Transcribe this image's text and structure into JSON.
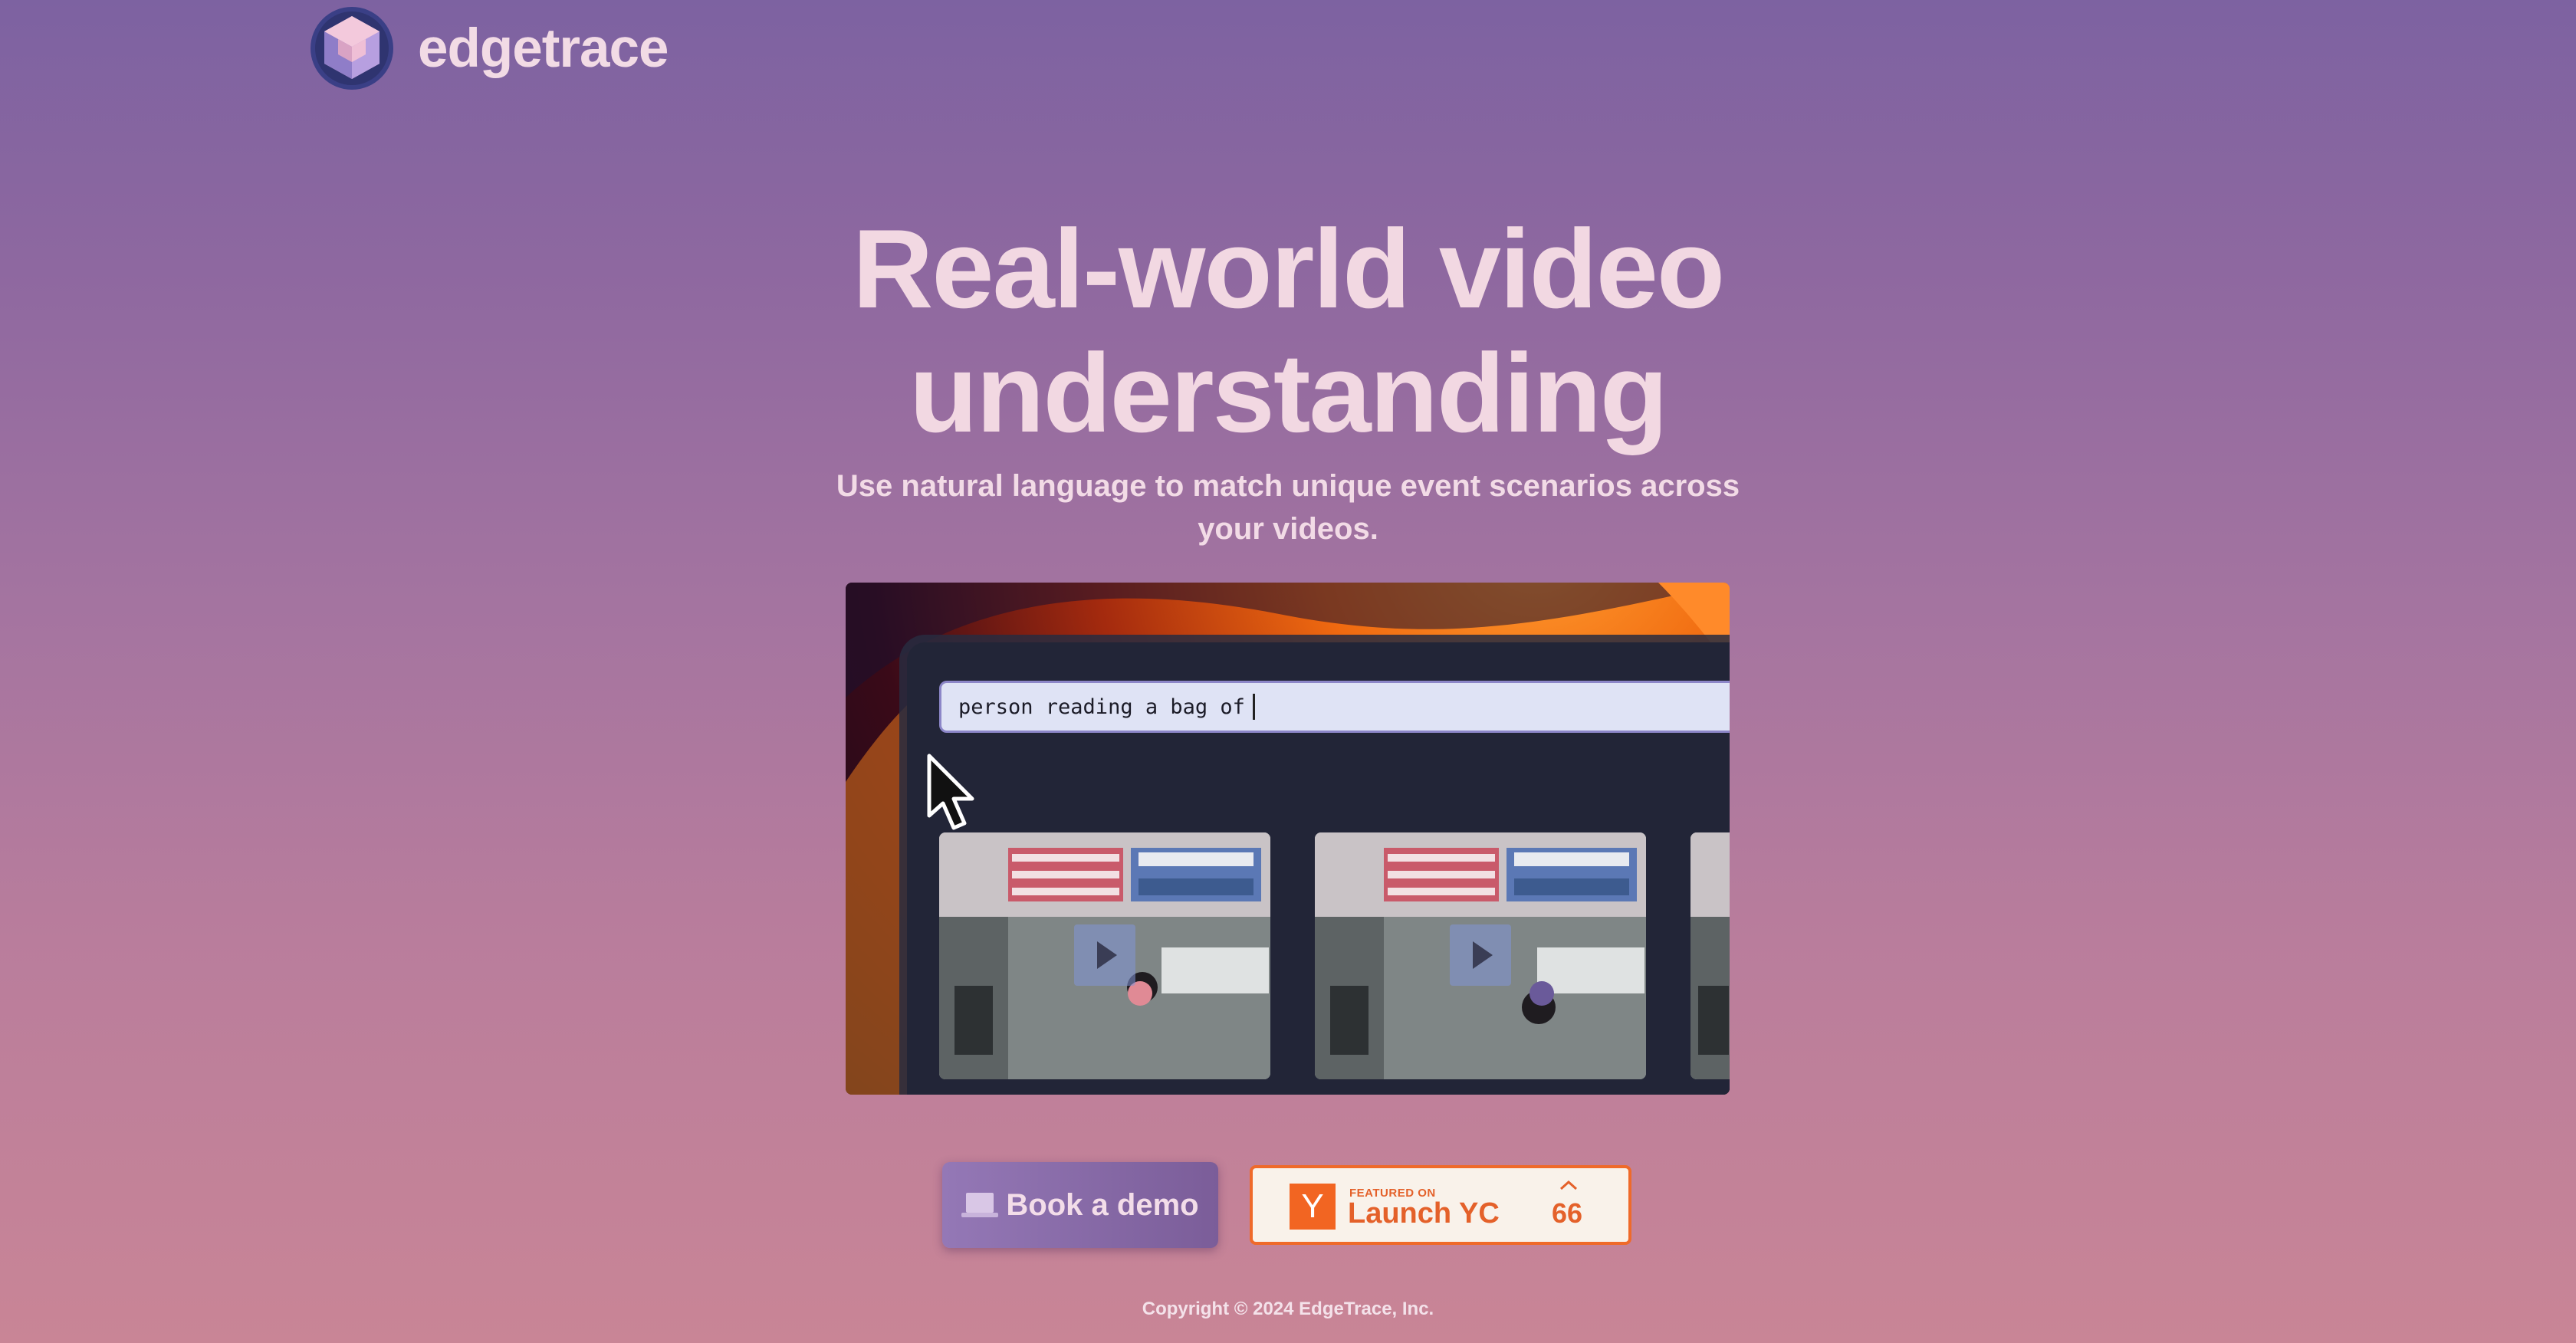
{
  "brand": {
    "name": "edgetrace",
    "logo_icon": "isometric-cube-logo"
  },
  "hero": {
    "title_line1": "Real-world video",
    "title_line2": "understanding",
    "subtitle": "Use natural language to match unique event scenarios across your videos."
  },
  "demo": {
    "search_text": "person reading a bag of",
    "icons": [
      "mouse-cursor-icon",
      "play-icon"
    ]
  },
  "cta": {
    "book_demo_label": "Book a demo",
    "book_demo_icon": "laptop-icon",
    "launch_yc": {
      "logo_letter": "Y",
      "featured_label": "FEATURED ON",
      "launch_label": "Launch YC",
      "upvote_icon": "chevron-up-icon",
      "upvote_count": "66"
    }
  },
  "footer": {
    "copyright": "Copyright © 2024 EdgeTrace, Inc."
  },
  "colors": {
    "bg_top": "#7d62a1",
    "bg_bottom": "#c98596",
    "title_text": "#f2d8e2",
    "yc_orange": "#e4612a",
    "book_demo_bg": "#8a6cab"
  }
}
